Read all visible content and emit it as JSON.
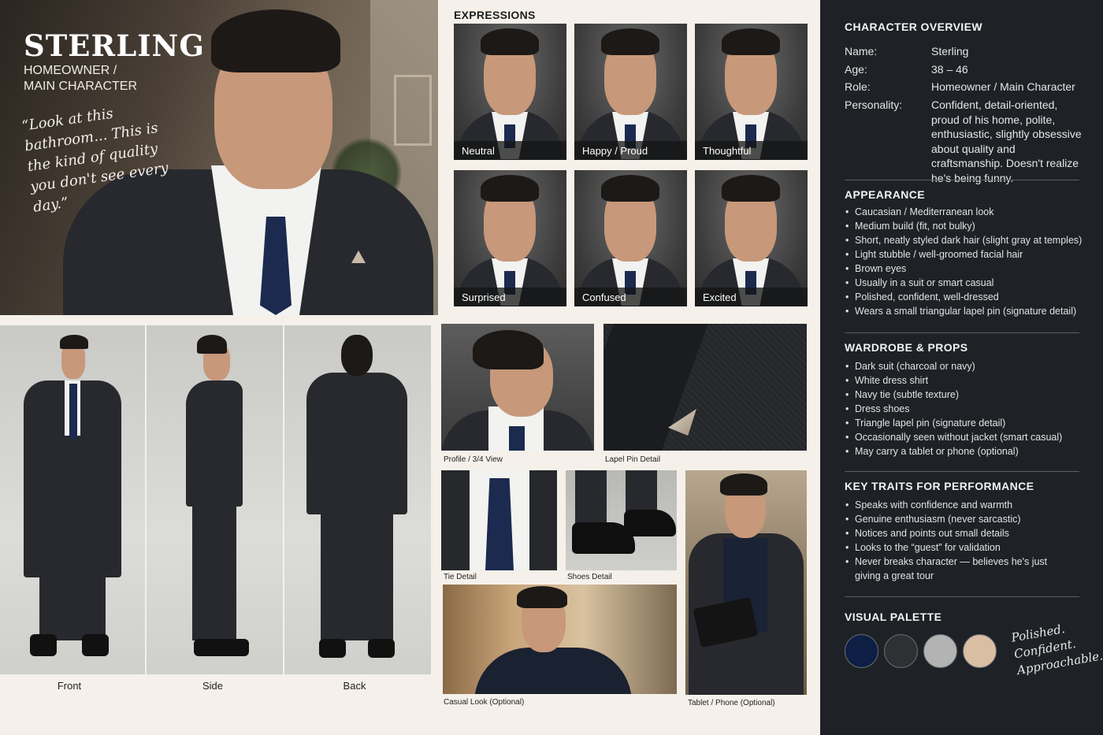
{
  "character": {
    "name": "STERLING",
    "role_line1": "HOMEOWNER /",
    "role_line2": "MAIN CHARACTER",
    "quote": "“Look at this bathroom... This is the kind of quality you don't see every day.”"
  },
  "expressions": {
    "title": "EXPRESSIONS",
    "items": [
      {
        "label": "Neutral"
      },
      {
        "label": "Happy / Proud"
      },
      {
        "label": "Thoughtful"
      },
      {
        "label": "Surprised"
      },
      {
        "label": "Confused"
      },
      {
        "label": "Excited"
      }
    ]
  },
  "turnaround": {
    "front": "Front",
    "side": "Side",
    "back": "Back"
  },
  "details": {
    "profile": "Profile / 3/4 View",
    "lapel": "Lapel Pin Detail",
    "tie": "Tie Detail",
    "shoes": "Shoes Detail",
    "casual": "Casual Look (Optional)",
    "tablet": "Tablet / Phone (Optional)"
  },
  "overview": {
    "title": "CHARACTER OVERVIEW",
    "name_key": "Name:",
    "name_val": "Sterling",
    "age_key": "Age:",
    "age_val": "38 – 46",
    "role_key": "Role:",
    "role_val": "Homeowner / Main Character",
    "pers_key": "Personality:",
    "pers_val": "Confident, detail-oriented, proud of his home, polite, enthusiastic, slightly obsessive about quality and craftsmanship. Doesn't realize he's being funny."
  },
  "appearance": {
    "title": "APPEARANCE",
    "items": [
      "Caucasian / Mediterranean look",
      "Medium build (fit, not bulky)",
      "Short, neatly styled dark hair (slight gray at temples)",
      "Light stubble / well-groomed facial hair",
      "Brown eyes",
      "Usually in a suit or smart casual",
      "Polished, confident, well-dressed",
      "Wears a small triangular lapel pin (signature detail)"
    ]
  },
  "wardrobe": {
    "title": "WARDROBE & PROPS",
    "items": [
      "Dark suit (charcoal or navy)",
      "White dress shirt",
      "Navy tie (subtle texture)",
      "Dress shoes",
      "Triangle lapel pin (signature detail)",
      "Occasionally seen without jacket (smart casual)",
      "May carry a tablet or phone (optional)"
    ]
  },
  "traits": {
    "title": "KEY TRAITS FOR PERFORMANCE",
    "items": [
      "Speaks with confidence and warmth",
      "Genuine enthusiasm (never sarcastic)",
      "Notices and points out small details",
      "Looks to the “guest” for validation",
      "Never breaks character — believes he's just giving a great tour"
    ]
  },
  "palette": {
    "title": "VISUAL PALETTE",
    "colors": [
      "#0d1f45",
      "#2e3134",
      "#b3b3b3",
      "#d9bea3"
    ],
    "tagline": "Polished. Confident. Approachable."
  },
  "icons": {
    "lapel_pin": "triangle-pin-icon"
  }
}
